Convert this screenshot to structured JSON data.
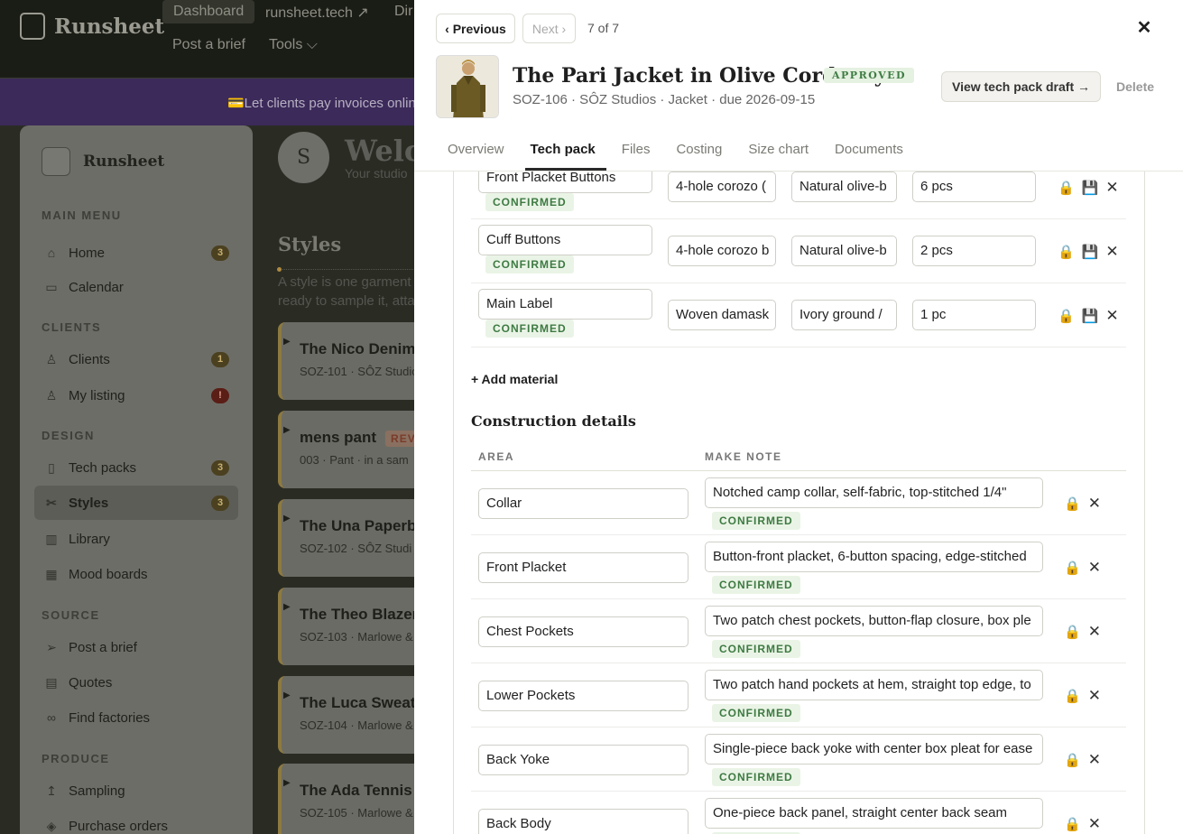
{
  "app": {
    "brand": "Runsheet",
    "nav": [
      "Dashboard",
      "runsheet.tech ↗",
      "Dir",
      "Post a brief",
      "Tools ⌵"
    ],
    "banner": "💳Let clients pay invoices onlin"
  },
  "sidebar": {
    "brand": "Runsheet",
    "sections": [
      {
        "title": "MAIN MENU",
        "items": [
          {
            "label": "Home",
            "icon": "home-icon",
            "glyph": "⌂",
            "badge": "3"
          },
          {
            "label": "Calendar",
            "icon": "calendar-icon",
            "glyph": "▭",
            "badge": ""
          }
        ]
      },
      {
        "title": "CLIENTS",
        "items": [
          {
            "label": "Clients",
            "icon": "user-icon",
            "glyph": "♙",
            "badge": "1"
          },
          {
            "label": "My listing",
            "icon": "user-icon",
            "glyph": "♙",
            "badge": "!"
          }
        ]
      },
      {
        "title": "DESIGN",
        "items": [
          {
            "label": "Tech packs",
            "icon": "document-icon",
            "glyph": "▯",
            "badge": "3"
          },
          {
            "label": "Styles",
            "icon": "scissors-icon",
            "glyph": "✂",
            "badge": "3"
          },
          {
            "label": "Library",
            "icon": "book-icon",
            "glyph": "▥",
            "badge": ""
          },
          {
            "label": "Mood boards",
            "icon": "grid-icon",
            "glyph": "▦",
            "badge": ""
          }
        ]
      },
      {
        "title": "SOURCE",
        "items": [
          {
            "label": "Post a brief",
            "icon": "send-icon",
            "glyph": "➢",
            "badge": ""
          },
          {
            "label": "Quotes",
            "icon": "chat-icon",
            "glyph": "▤",
            "badge": ""
          },
          {
            "label": "Find factories",
            "icon": "link-icon",
            "glyph": "∞",
            "badge": ""
          }
        ]
      },
      {
        "title": "PRODUCE",
        "items": [
          {
            "label": "Sampling",
            "icon": "arrow-up-icon",
            "glyph": "↥",
            "badge": ""
          },
          {
            "label": "Purchase orders",
            "icon": "box-icon",
            "glyph": "◈",
            "badge": ""
          }
        ]
      }
    ]
  },
  "dashboard": {
    "avatar_initial": "S",
    "welcome": "Welco",
    "studio_sub": "Your studio",
    "styles_heading": "Styles",
    "styles_desc": [
      "A style is one garment",
      "ready to sample it, atta"
    ],
    "cards": [
      {
        "title": "The Nico Denim",
        "sub": "SOZ-101 · SÔZ Studio",
        "badge": ""
      },
      {
        "title": "mens pant",
        "sub": "003 · Pant · in a sam",
        "badge": "REV"
      },
      {
        "title": "The Una Paperb",
        "sub": "SOZ-102 · SÔZ Studi",
        "badge": ""
      },
      {
        "title": "The Theo Blazer",
        "sub": "SOZ-103 · Marlowe &",
        "badge": ""
      },
      {
        "title": "The Luca Sweat",
        "sub": "SOZ-104 · Marlowe &",
        "badge": ""
      },
      {
        "title": "The Ada Tennis",
        "sub": "SOZ-105 · Marlowe &",
        "badge": ""
      }
    ]
  },
  "drawer": {
    "prev": "‹ Previous",
    "next": "Next ›",
    "counter": "7 of 7",
    "title": "The Pari Jacket in Olive Corduroy",
    "status": "APPROVED",
    "meta": "SOZ-106 · SÔZ Studios · Jacket · due 2026-09-15",
    "view_btn": "View tech pack draft →",
    "delete_btn": "Delete",
    "tabs": [
      "Overview",
      "Tech pack",
      "Files",
      "Costing",
      "Size chart",
      "Documents"
    ],
    "active_tab": "Tech pack",
    "materials": [
      {
        "name": "Front Placket Buttons",
        "status": "CONFIRMED",
        "material": "4-hole corozo (",
        "color": "Natural olive-b",
        "qty": "6 pcs"
      },
      {
        "name": "Cuff Buttons",
        "status": "CONFIRMED",
        "material": "4-hole corozo b",
        "color": "Natural olive-b",
        "qty": "2 pcs"
      },
      {
        "name": "Main Label",
        "status": "CONFIRMED",
        "material": "Woven damask",
        "color": "Ivory ground / ",
        "qty": "1 pc"
      }
    ],
    "add_material": "+ Add material",
    "construction_heading": "Construction details",
    "construction_cols": [
      "AREA",
      "MAKE NOTE"
    ],
    "construction": [
      {
        "area": "Collar",
        "note": "Notched camp collar, self-fabric, top-stitched 1/4\"",
        "status": "CONFIRMED"
      },
      {
        "area": "Front Placket",
        "note": "Button-front placket, 6-button spacing, edge-stitched",
        "status": "CONFIRMED"
      },
      {
        "area": "Chest Pockets",
        "note": "Two patch chest pockets, button-flap closure, box ple",
        "status": "CONFIRMED"
      },
      {
        "area": "Lower Pockets",
        "note": "Two patch hand pockets at hem, straight top edge, to",
        "status": "CONFIRMED"
      },
      {
        "area": "Back Yoke",
        "note": "Single-piece back yoke with center box pleat for ease",
        "status": "CONFIRMED"
      },
      {
        "area": "Back Body",
        "note": "One-piece back panel, straight center back seam",
        "status": "CONFIRMED"
      }
    ]
  }
}
